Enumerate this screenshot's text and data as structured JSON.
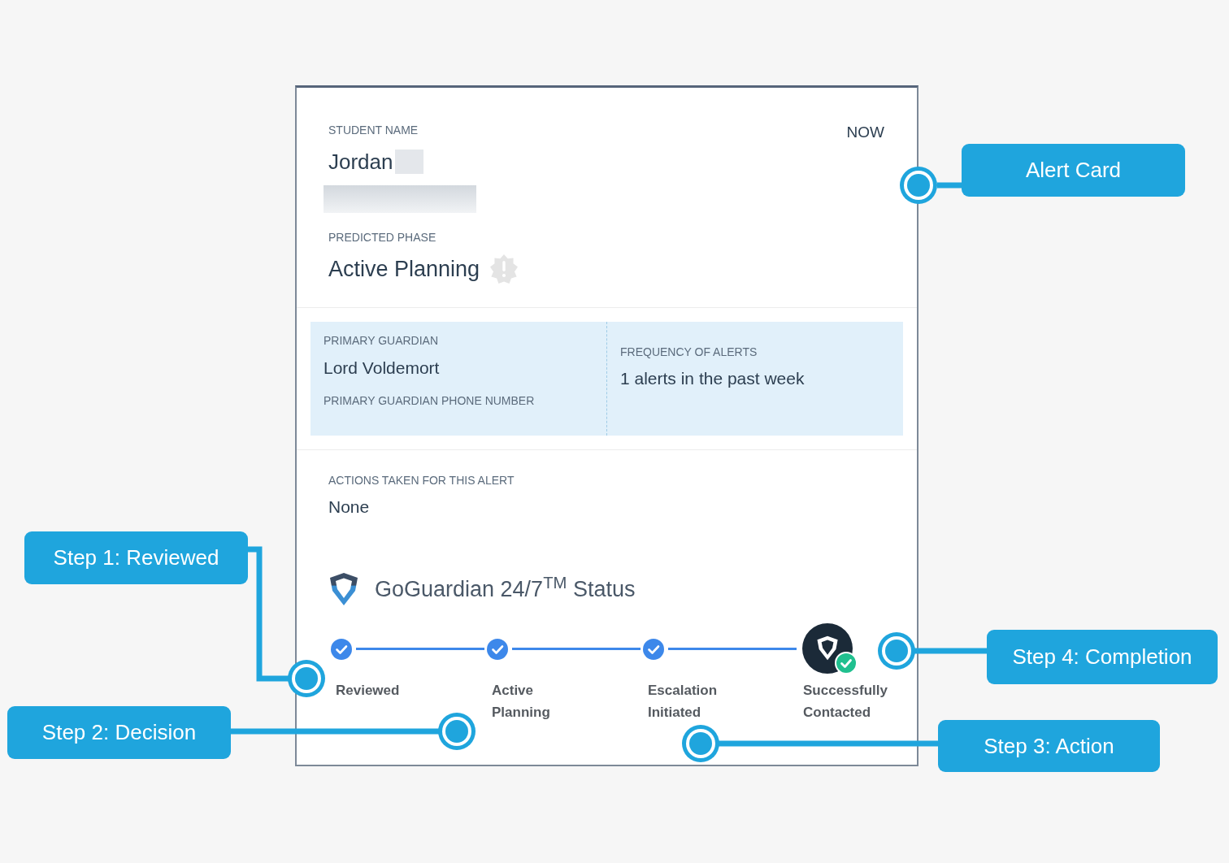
{
  "alert_card": {
    "student_name_label": "STUDENT NAME",
    "time": "NOW",
    "student_name": "Jordan",
    "predicted_phase_label": "PREDICTED PHASE",
    "predicted_phase": "Active Planning",
    "guardian": {
      "label": "PRIMARY GUARDIAN",
      "name": "Lord Voldemort",
      "phone_label": "PRIMARY GUARDIAN PHONE NUMBER"
    },
    "frequency": {
      "label": "FREQUENCY OF ALERTS",
      "value": "1 alerts in the past week"
    },
    "actions": {
      "label": "ACTIONS TAKEN FOR THIS ALERT",
      "value": "None"
    },
    "status": {
      "title": "GoGuardian 24/7$^{TM}$ Status",
      "steps": [
        {
          "kind": "check",
          "label": "Reviewed",
          "done": true
        },
        {
          "kind": "check",
          "label": "Active Planning",
          "done": true
        },
        {
          "kind": "check",
          "label": "Escalation Initiated",
          "done": true
        },
        {
          "kind": "final",
          "label": "Successfully Contacted",
          "done": true
        }
      ]
    }
  },
  "callouts": [
    {
      "label": "Alert Card"
    },
    {
      "label": "Step 1: Reviewed"
    },
    {
      "label": "Step 4: Completion"
    },
    {
      "label": "Step 2: Decision"
    },
    {
      "label": "Step 3: Action"
    }
  ]
}
